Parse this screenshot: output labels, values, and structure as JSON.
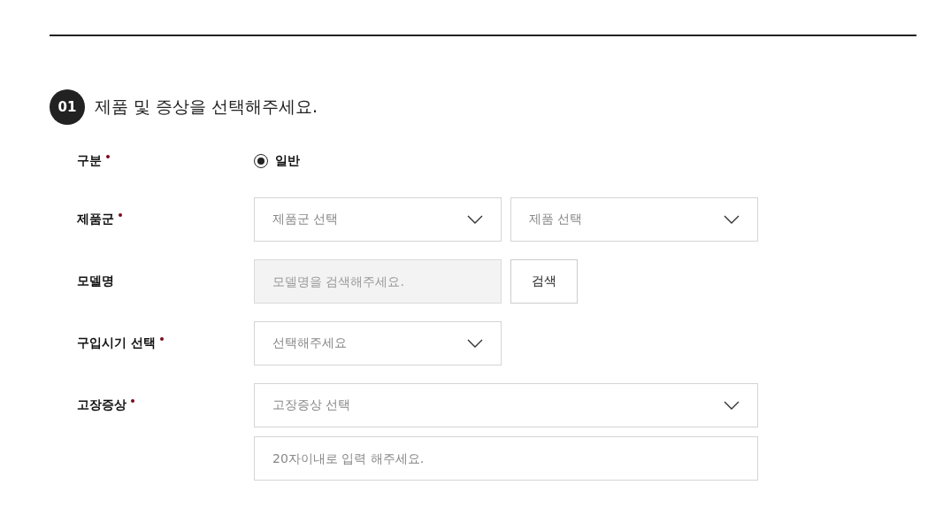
{
  "section": {
    "number": "01",
    "title": "제품 및 증상을 선택해주세요."
  },
  "rows": [
    {
      "label": "구분",
      "required": true,
      "controls": [
        {
          "kind": "radio",
          "label": "일반",
          "selected": true
        }
      ]
    },
    {
      "label": "제품군",
      "required": true,
      "controls": [
        {
          "kind": "select",
          "placeholder": "제품군 선택"
        },
        {
          "kind": "select",
          "placeholder": "제품 선택"
        }
      ]
    },
    {
      "label": "모델명",
      "required": false,
      "controls": [
        {
          "kind": "input",
          "placeholder": "모델명을 검색해주세요.",
          "disabled": true
        },
        {
          "kind": "button",
          "label": "검색"
        }
      ]
    },
    {
      "label": "구입시기 선택",
      "required": true,
      "controls": [
        {
          "kind": "select",
          "placeholder": "선택해주세요"
        }
      ]
    },
    {
      "label": "고장증상",
      "required": true,
      "controls": [
        {
          "kind": "wide_select",
          "placeholder": "고장증상 선택"
        },
        {
          "kind": "wide_input",
          "placeholder": "20자이내로 입력 해주세요.",
          "disabled": false
        }
      ]
    }
  ]
}
